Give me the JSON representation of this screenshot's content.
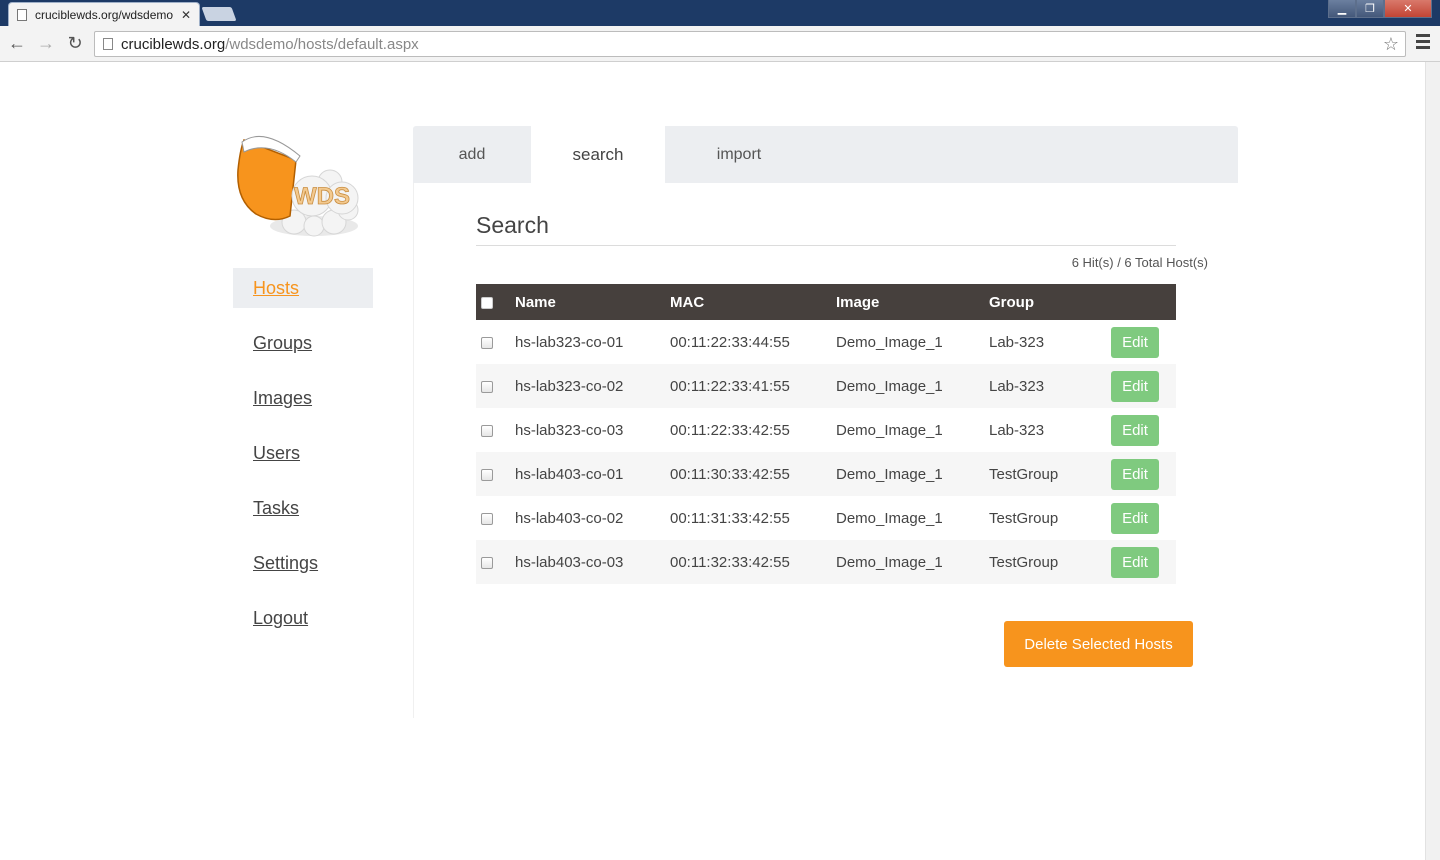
{
  "browser": {
    "tab_title": "cruciblewds.org/wdsdemo",
    "url_host": "cruciblewds.org",
    "url_path": "/wdsdemo/hosts/default.aspx"
  },
  "logo": {
    "text": "WDS"
  },
  "sidebar": {
    "items": [
      {
        "label": "Hosts",
        "active": true
      },
      {
        "label": "Groups"
      },
      {
        "label": "Images"
      },
      {
        "label": "Users"
      },
      {
        "label": "Tasks"
      },
      {
        "label": "Settings"
      },
      {
        "label": "Logout"
      }
    ]
  },
  "tabs": [
    {
      "label": "add"
    },
    {
      "label": "search",
      "active": true
    },
    {
      "label": "import"
    }
  ],
  "search": {
    "title": "Search",
    "hits": "6 Hit(s) / 6 Total Host(s)"
  },
  "table": {
    "headers": {
      "name": "Name",
      "mac": "MAC",
      "image": "Image",
      "group": "Group"
    },
    "edit_label": "Edit",
    "rows": [
      {
        "name": "hs-lab323-co-01",
        "mac": "00:11:22:33:44:55",
        "image": "Demo_Image_1",
        "group": "Lab-323"
      },
      {
        "name": "hs-lab323-co-02",
        "mac": "00:11:22:33:41:55",
        "image": "Demo_Image_1",
        "group": "Lab-323"
      },
      {
        "name": "hs-lab323-co-03",
        "mac": "00:11:22:33:42:55",
        "image": "Demo_Image_1",
        "group": "Lab-323"
      },
      {
        "name": "hs-lab403-co-01",
        "mac": "00:11:30:33:42:55",
        "image": "Demo_Image_1",
        "group": "TestGroup"
      },
      {
        "name": "hs-lab403-co-02",
        "mac": "00:11:31:33:42:55",
        "image": "Demo_Image_1",
        "group": "TestGroup"
      },
      {
        "name": "hs-lab403-co-03",
        "mac": "00:11:32:33:42:55",
        "image": "Demo_Image_1",
        "group": "TestGroup"
      }
    ]
  },
  "actions": {
    "delete_label": "Delete Selected Hosts"
  },
  "colors": {
    "accent": "#f7941d",
    "edit": "#7fca7f",
    "table_header": "#46403d"
  }
}
